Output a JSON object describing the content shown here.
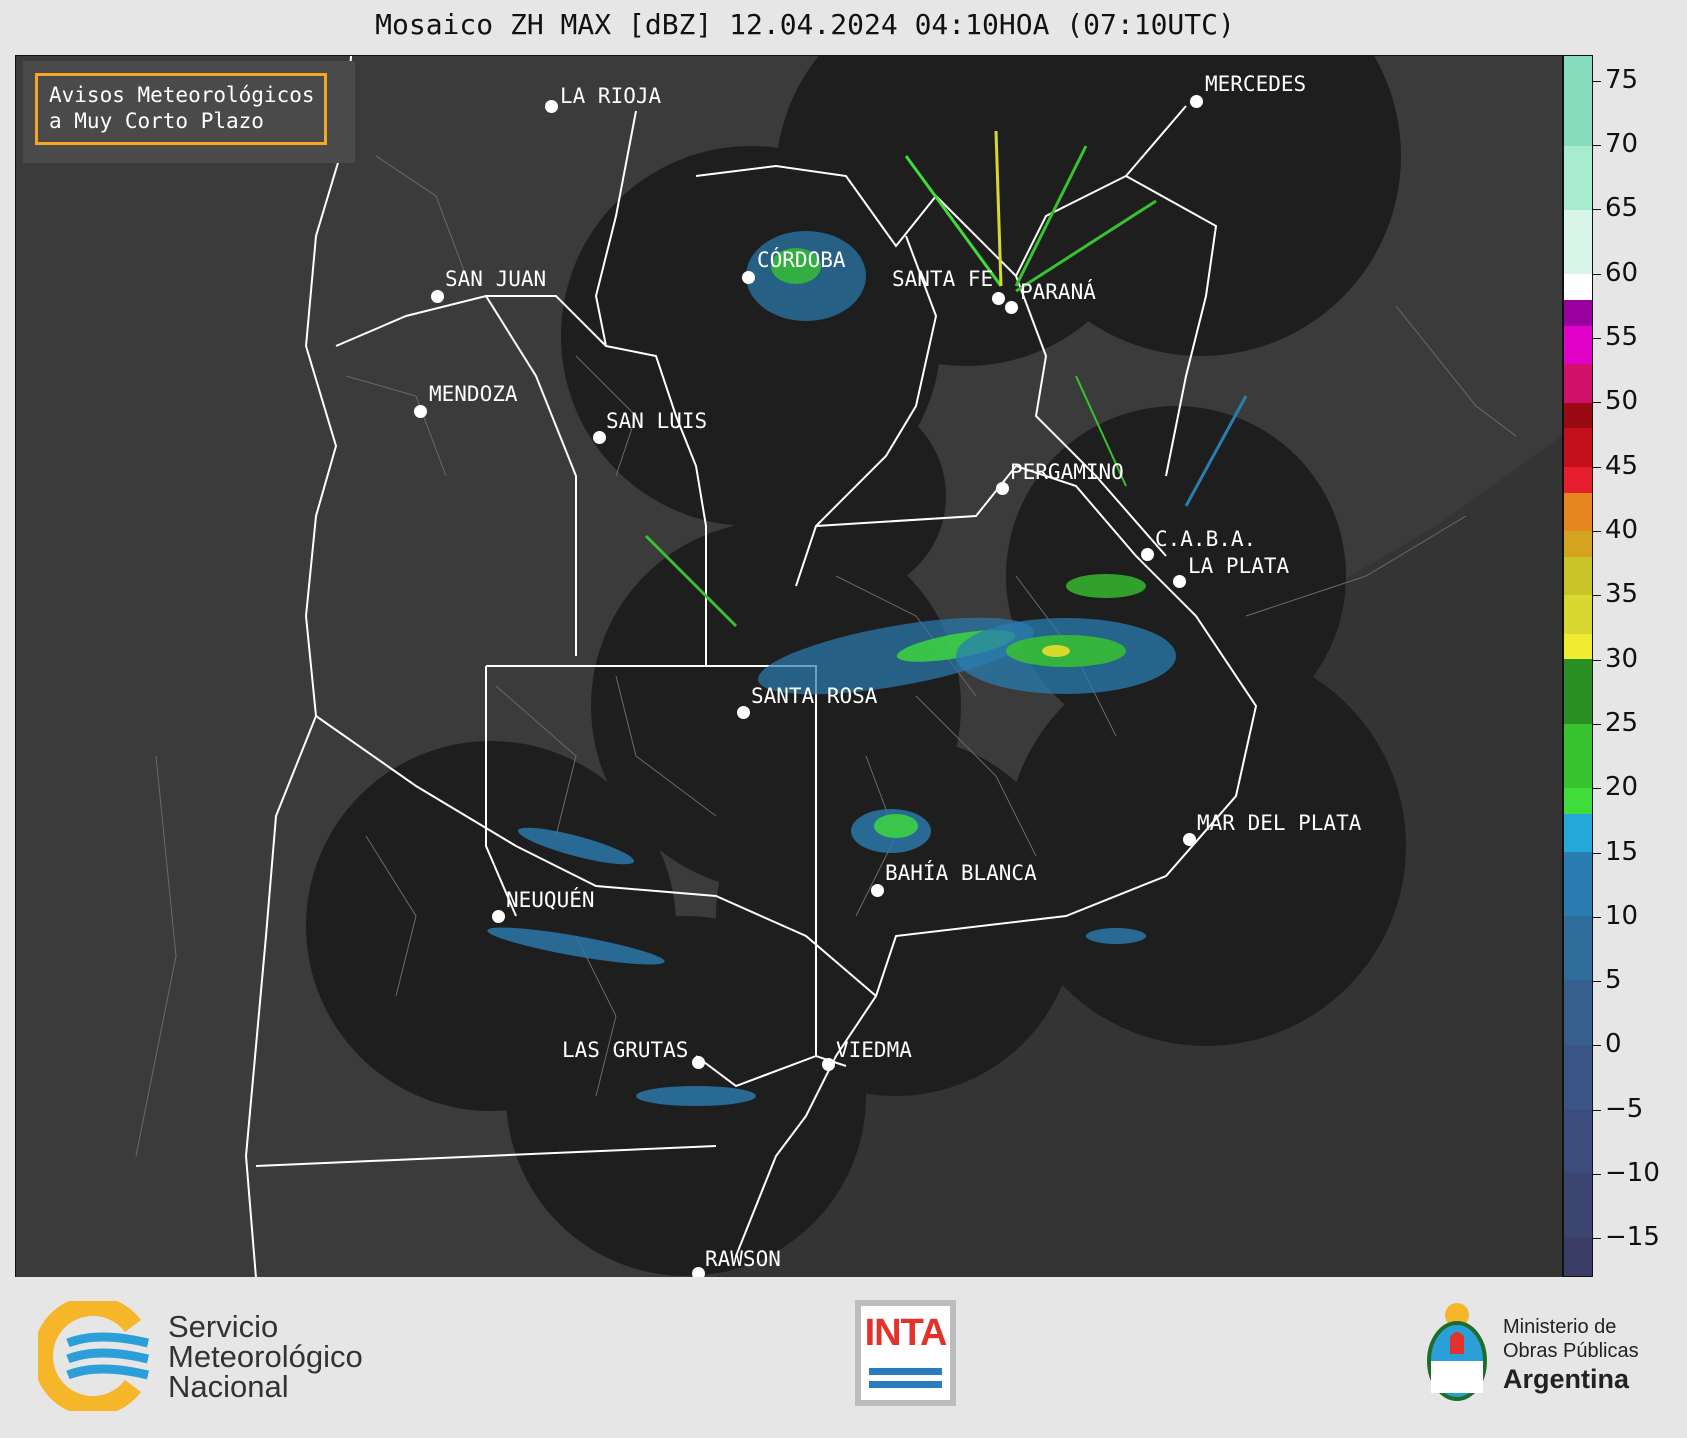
{
  "title": "Mosaico ZH MAX [dBZ] 12.04.2024 04:10HOA (07:10UTC)",
  "badge": {
    "line1": "Avisos Meteorológicos",
    "line2": "a Muy Corto Plazo",
    "border_color": "#f5a623"
  },
  "colorbar": {
    "min": -18,
    "max": 77,
    "ticks": [
      "75",
      "70",
      "65",
      "60",
      "55",
      "50",
      "45",
      "40",
      "35",
      "30",
      "25",
      "20",
      "15",
      "10",
      "5",
      "0",
      "−5",
      "−10",
      "−15"
    ],
    "tick_values": [
      75,
      70,
      65,
      60,
      55,
      50,
      45,
      40,
      35,
      30,
      25,
      20,
      15,
      10,
      5,
      0,
      -5,
      -10,
      -15
    ],
    "bands": [
      {
        "from": -18,
        "to": -15,
        "color": "#3a3d66"
      },
      {
        "from": -15,
        "to": -10,
        "color": "#3c4470"
      },
      {
        "from": -10,
        "to": -5,
        "color": "#3c4c7c"
      },
      {
        "from": -5,
        "to": 0,
        "color": "#3a5585"
      },
      {
        "from": 0,
        "to": 5,
        "color": "#37608e"
      },
      {
        "from": 5,
        "to": 10,
        "color": "#2f6d9c"
      },
      {
        "from": 10,
        "to": 15,
        "color": "#2a7db0"
      },
      {
        "from": 15,
        "to": 18,
        "color": "#24a8d8"
      },
      {
        "from": 18,
        "to": 20,
        "color": "#3fdc3a"
      },
      {
        "from": 20,
        "to": 25,
        "color": "#37c22f"
      },
      {
        "from": 25,
        "to": 30,
        "color": "#2a8f23"
      },
      {
        "from": 30,
        "to": 32,
        "color": "#f0ec30"
      },
      {
        "from": 32,
        "to": 35,
        "color": "#d8d830"
      },
      {
        "from": 35,
        "to": 38,
        "color": "#c9c42a"
      },
      {
        "from": 38,
        "to": 40,
        "color": "#d4a420"
      },
      {
        "from": 40,
        "to": 43,
        "color": "#e6861e"
      },
      {
        "from": 43,
        "to": 45,
        "color": "#e61e2e"
      },
      {
        "from": 45,
        "to": 48,
        "color": "#c4101c"
      },
      {
        "from": 48,
        "to": 50,
        "color": "#9a0a14"
      },
      {
        "from": 50,
        "to": 53,
        "color": "#d0106a"
      },
      {
        "from": 53,
        "to": 56,
        "color": "#e000c8"
      },
      {
        "from": 56,
        "to": 58,
        "color": "#9a00a0"
      },
      {
        "from": 58,
        "to": 60,
        "color": "#ffffff"
      },
      {
        "from": 60,
        "to": 65,
        "color": "#d8f5ea"
      },
      {
        "from": 65,
        "to": 70,
        "color": "#a8ecd0"
      },
      {
        "from": 70,
        "to": 77,
        "color": "#86dcbd"
      }
    ]
  },
  "cities": [
    {
      "name": "LA RIOJA"
    },
    {
      "name": "MERCEDES"
    },
    {
      "name": "CÓRDOBA"
    },
    {
      "name": "SAN JUAN"
    },
    {
      "name": "SANTA FE"
    },
    {
      "name": "PARANÁ"
    },
    {
      "name": "MENDOZA"
    },
    {
      "name": "SAN LUIS"
    },
    {
      "name": "PERGAMINO"
    },
    {
      "name": "C.A.B.A."
    },
    {
      "name": "LA PLATA"
    },
    {
      "name": "SANTA ROSA"
    },
    {
      "name": "MAR DEL PLATA"
    },
    {
      "name": "BAHÍA BLANCA"
    },
    {
      "name": "NEUQUÉN"
    },
    {
      "name": "LAS GRUTAS"
    },
    {
      "name": "VIEDMA"
    },
    {
      "name": "RAWSON"
    }
  ],
  "footer": {
    "smn": [
      "Servicio",
      "Meteorológico",
      "Nacional"
    ],
    "inta": "INTA",
    "ministerio": [
      "Ministerio de",
      "Obras Públicas",
      "Argentina"
    ]
  }
}
